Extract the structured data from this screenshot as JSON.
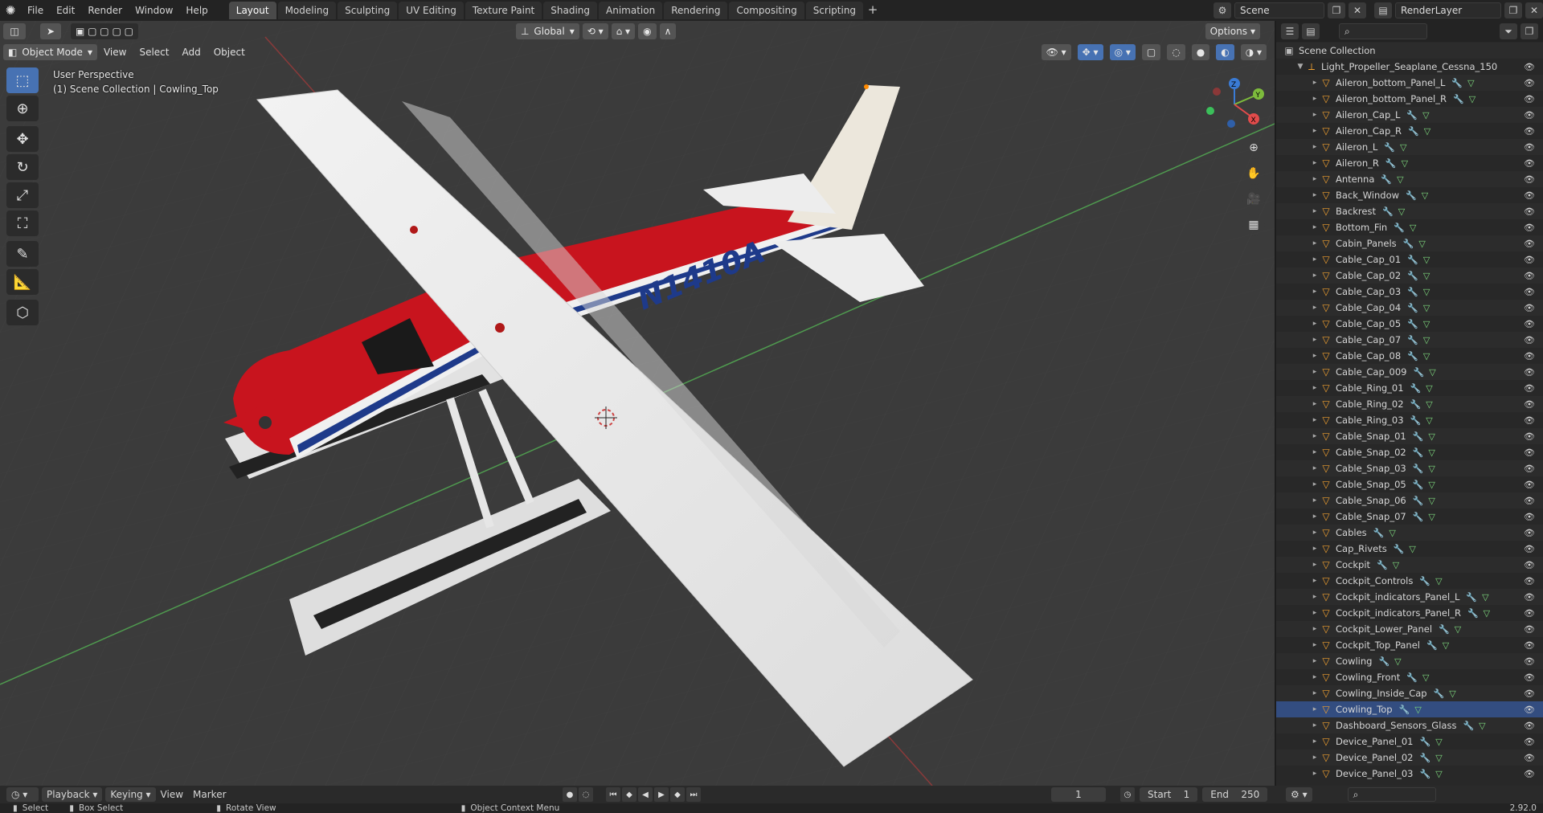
{
  "menu": {
    "items": [
      "File",
      "Edit",
      "Render",
      "Window",
      "Help"
    ]
  },
  "workspaces": {
    "tabs": [
      "Layout",
      "Modeling",
      "Sculpting",
      "UV Editing",
      "Texture Paint",
      "Shading",
      "Animation",
      "Rendering",
      "Compositing",
      "Scripting"
    ],
    "active": "Layout"
  },
  "topbar": {
    "scene": "Scene",
    "render_layer": "RenderLayer"
  },
  "viewport_header": {
    "mode": "Object Mode",
    "menus": [
      "View",
      "Select",
      "Add",
      "Object"
    ],
    "transform_orientation": "Global",
    "options": "Options"
  },
  "viewport_overlay": {
    "perspective": "User Perspective",
    "context": "(1) Scene Collection | Cowling_Top",
    "tail_number": "N1410A"
  },
  "gizmo": {
    "x": "X",
    "y": "Y",
    "z": "Z"
  },
  "outliner": {
    "root": "Scene Collection",
    "collection": "Light_Propeller_Seaplane_Cessna_150",
    "selected": "Cowling_Top",
    "items": [
      "Aileron_bottom_Panel_L",
      "Aileron_bottom_Panel_R",
      "Aileron_Cap_L",
      "Aileron_Cap_R",
      "Aileron_L",
      "Aileron_R",
      "Antenna",
      "Back_Window",
      "Backrest",
      "Bottom_Fin",
      "Cabin_Panels",
      "Cable_Cap_01",
      "Cable_Cap_02",
      "Cable_Cap_03",
      "Cable_Cap_04",
      "Cable_Cap_05",
      "Cable_Cap_07",
      "Cable_Cap_08",
      "Cable_Cap_009",
      "Cable_Ring_01",
      "Cable_Ring_02",
      "Cable_Ring_03",
      "Cable_Snap_01",
      "Cable_Snap_02",
      "Cable_Snap_03",
      "Cable_Snap_05",
      "Cable_Snap_06",
      "Cable_Snap_07",
      "Cables",
      "Cap_Rivets",
      "Cockpit",
      "Cockpit_Controls",
      "Cockpit_indicators_Panel_L",
      "Cockpit_indicators_Panel_R",
      "Cockpit_Lower_Panel",
      "Cockpit_Top_Panel",
      "Cowling",
      "Cowling_Front",
      "Cowling_Inside_Cap",
      "Cowling_Top",
      "Dashboard_Sensors_Glass",
      "Device_Panel_01",
      "Device_Panel_02",
      "Device_Panel_03"
    ]
  },
  "timeline": {
    "menus": [
      "Playback",
      "Keying",
      "View",
      "Marker"
    ],
    "current_frame": "1",
    "start_label": "Start",
    "start": "1",
    "end_label": "End",
    "end": "250"
  },
  "statusbar": {
    "select": "Select",
    "box_select": "Box Select",
    "rotate": "Rotate View",
    "context_menu": "Object Context Menu",
    "version": "2.92.0"
  },
  "colors": {
    "accent": "#4772b3",
    "plane_red": "#c8141e",
    "plane_white": "#eeeeee",
    "stripe_blue": "#1e3a8a"
  }
}
